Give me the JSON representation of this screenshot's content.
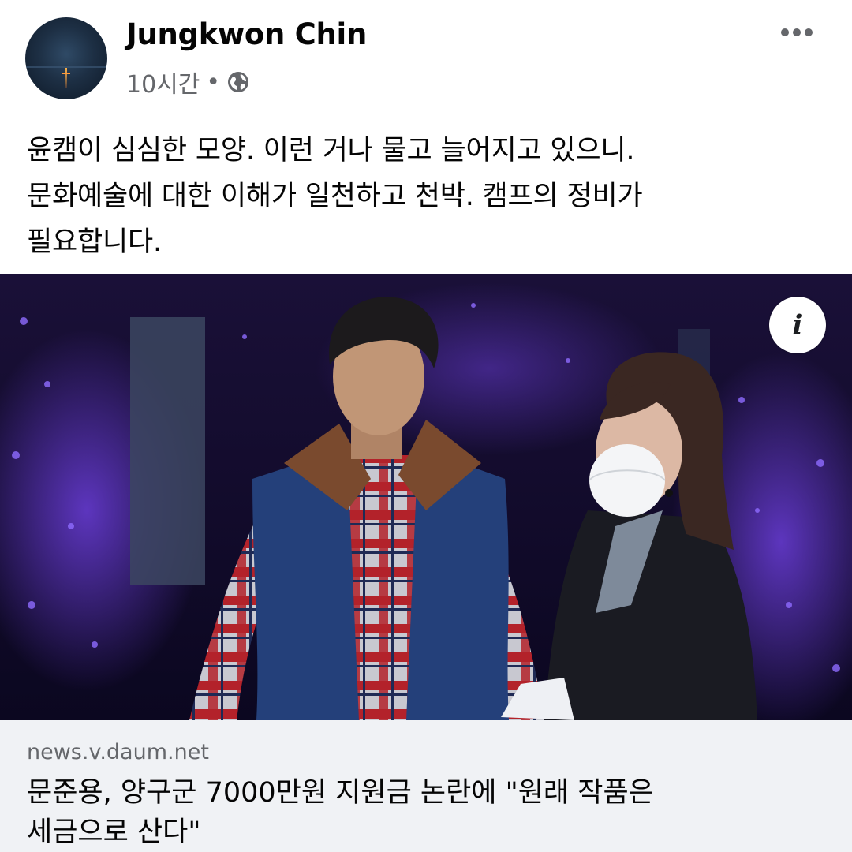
{
  "post": {
    "author": "Jungkwon Chin",
    "time": "10시간",
    "separator": "•",
    "audience_icon": "globe-icon",
    "more_icon": "more-options-icon",
    "text_lines": [
      "윤캠이 심심한 모양. 이런 거나 물고 늘어지고 있으니.",
      "문화예술에 대한 이해가 일천하고 천박. 캠프의 정비가",
      "필요합니다."
    ]
  },
  "link": {
    "info_icon": "info-icon",
    "domain": "news.v.daum.net",
    "headline_lines": [
      "문준용, 양구군 7000만원 지원금 논란에 \"원래 작품은",
      "세금으로 산다\""
    ]
  },
  "colors": {
    "text": "#050505",
    "secondary": "#65676b",
    "preview_bg": "#f0f2f5",
    "photo_bg": "#120b28"
  }
}
